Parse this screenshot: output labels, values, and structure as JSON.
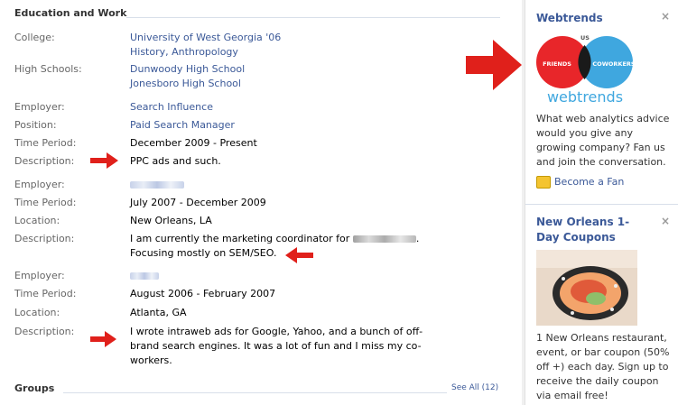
{
  "education": {
    "title": "Education and Work",
    "rows": [
      {
        "label": "College:",
        "value": "University of West Georgia '06",
        "link": true
      },
      {
        "label": "",
        "value": "History, Anthropology",
        "link": true
      },
      {
        "label": "High Schools:",
        "value": "Dunwoody High School",
        "link": true
      },
      {
        "label": "",
        "value": "Jonesboro High School",
        "link": true
      },
      {
        "label": "Employer:",
        "value": "Search Influence",
        "link": true
      },
      {
        "label": "Position:",
        "value": "Paid Search Manager",
        "link": true
      },
      {
        "label": "Time Period:",
        "value": "December 2009 - Present",
        "link": false
      },
      {
        "label": "Description:",
        "value": "PPC ads and such.",
        "link": false
      },
      {
        "label": "Employer:",
        "value": "",
        "link": true
      },
      {
        "label": "Time Period:",
        "value": "July 2007 - December 2009",
        "link": false
      },
      {
        "label": "Location:",
        "value": "New Orleans, LA",
        "link": false
      },
      {
        "label": "Description:",
        "value": "I am currently the marketing coordinator for",
        "link": false
      },
      {
        "label": "",
        "value": "Focusing mostly on SEM/SEO.",
        "link": false
      },
      {
        "label": "Employer:",
        "value": "",
        "link": true
      },
      {
        "label": "Time Period:",
        "value": "August 2006 - February 2007",
        "link": false
      },
      {
        "label": "Location:",
        "value": "Atlanta, GA",
        "link": false
      },
      {
        "label": "Description:",
        "value": "I wrote intraweb ads for Google, Yahoo, and a bunch of off-",
        "link": false
      },
      {
        "label": "",
        "value": "brand search engines. It was a lot of fun and I miss my co-",
        "link": false
      },
      {
        "label": "",
        "value": "workers.",
        "link": false
      }
    ]
  },
  "groups": {
    "title": "Groups",
    "see_all": "See All (12)"
  },
  "sidebar": {
    "ad1": {
      "title": "Webtrends",
      "close": "×",
      "logo_left": "FRIENDS",
      "logo_right": "COWORKERS",
      "logo_center": "US",
      "logo_text": "webtrends",
      "body": "What web analytics advice would you give any growing company? Fan us and join the conversation.",
      "fan": "Become a Fan"
    },
    "ad2": {
      "title": "New Orleans 1-Day Coupons",
      "title_line1": "New Orleans 1-",
      "title_line2": "Day Coupons",
      "close": "×",
      "body": "1 New Orleans restaurant, event, or bar coupon (50% off +) each day. Sign up to receive the daily coupon via email free!"
    }
  },
  "colors": {
    "link": "#3b5998",
    "arrow": "#e0201b",
    "friends": "#e8262a",
    "coworkers": "#3fa7df"
  }
}
